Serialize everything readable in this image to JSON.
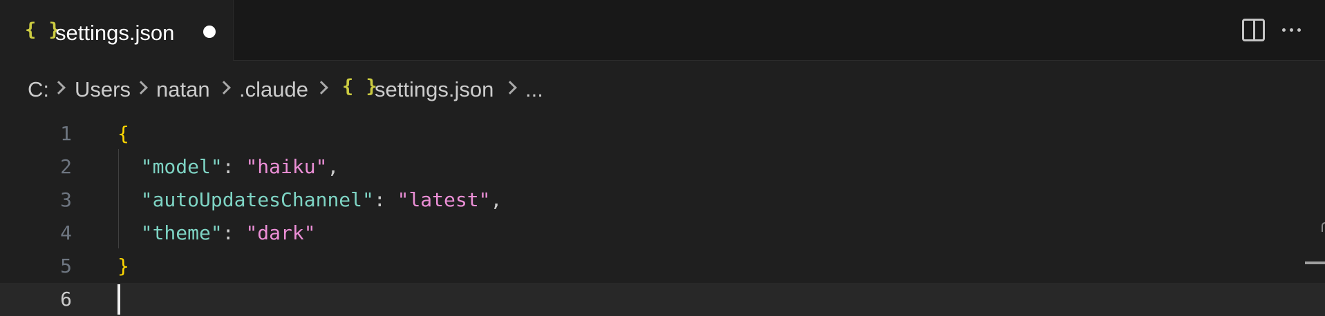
{
  "tab": {
    "icon": "{ }",
    "icon_name": "json-braces-icon",
    "label": "settings.json",
    "dirty": true
  },
  "tab_actions": {
    "split_icon": "split-editor-icon",
    "more_icon": "more-actions-icon"
  },
  "breadcrumbs": {
    "drive": "C:",
    "users": "Users",
    "user": "natan",
    "folder": ".claude",
    "file_icon": "{ }",
    "file": "settings.json",
    "tail": "..."
  },
  "editor": {
    "current_line": 6,
    "lines": [
      {
        "number": "1"
      },
      {
        "number": "2",
        "key": "\"model\"",
        "colon": ": ",
        "value": "\"haiku\"",
        "trail": ","
      },
      {
        "number": "3",
        "key": "\"autoUpdatesChannel\"",
        "colon": ": ",
        "value": "\"latest\"",
        "trail": ","
      },
      {
        "number": "4",
        "key": "\"theme\"",
        "colon": ": ",
        "value": "\"dark\"",
        "trail": ""
      },
      {
        "number": "5"
      },
      {
        "number": "6"
      }
    ],
    "open_brace": "{",
    "close_brace": "}"
  },
  "colors": {
    "json_icon": "#cbcb41",
    "key": "#7ed4c4",
    "string": "#eb8fd6",
    "brace": "#ffd700",
    "background": "#1f1f1f"
  }
}
